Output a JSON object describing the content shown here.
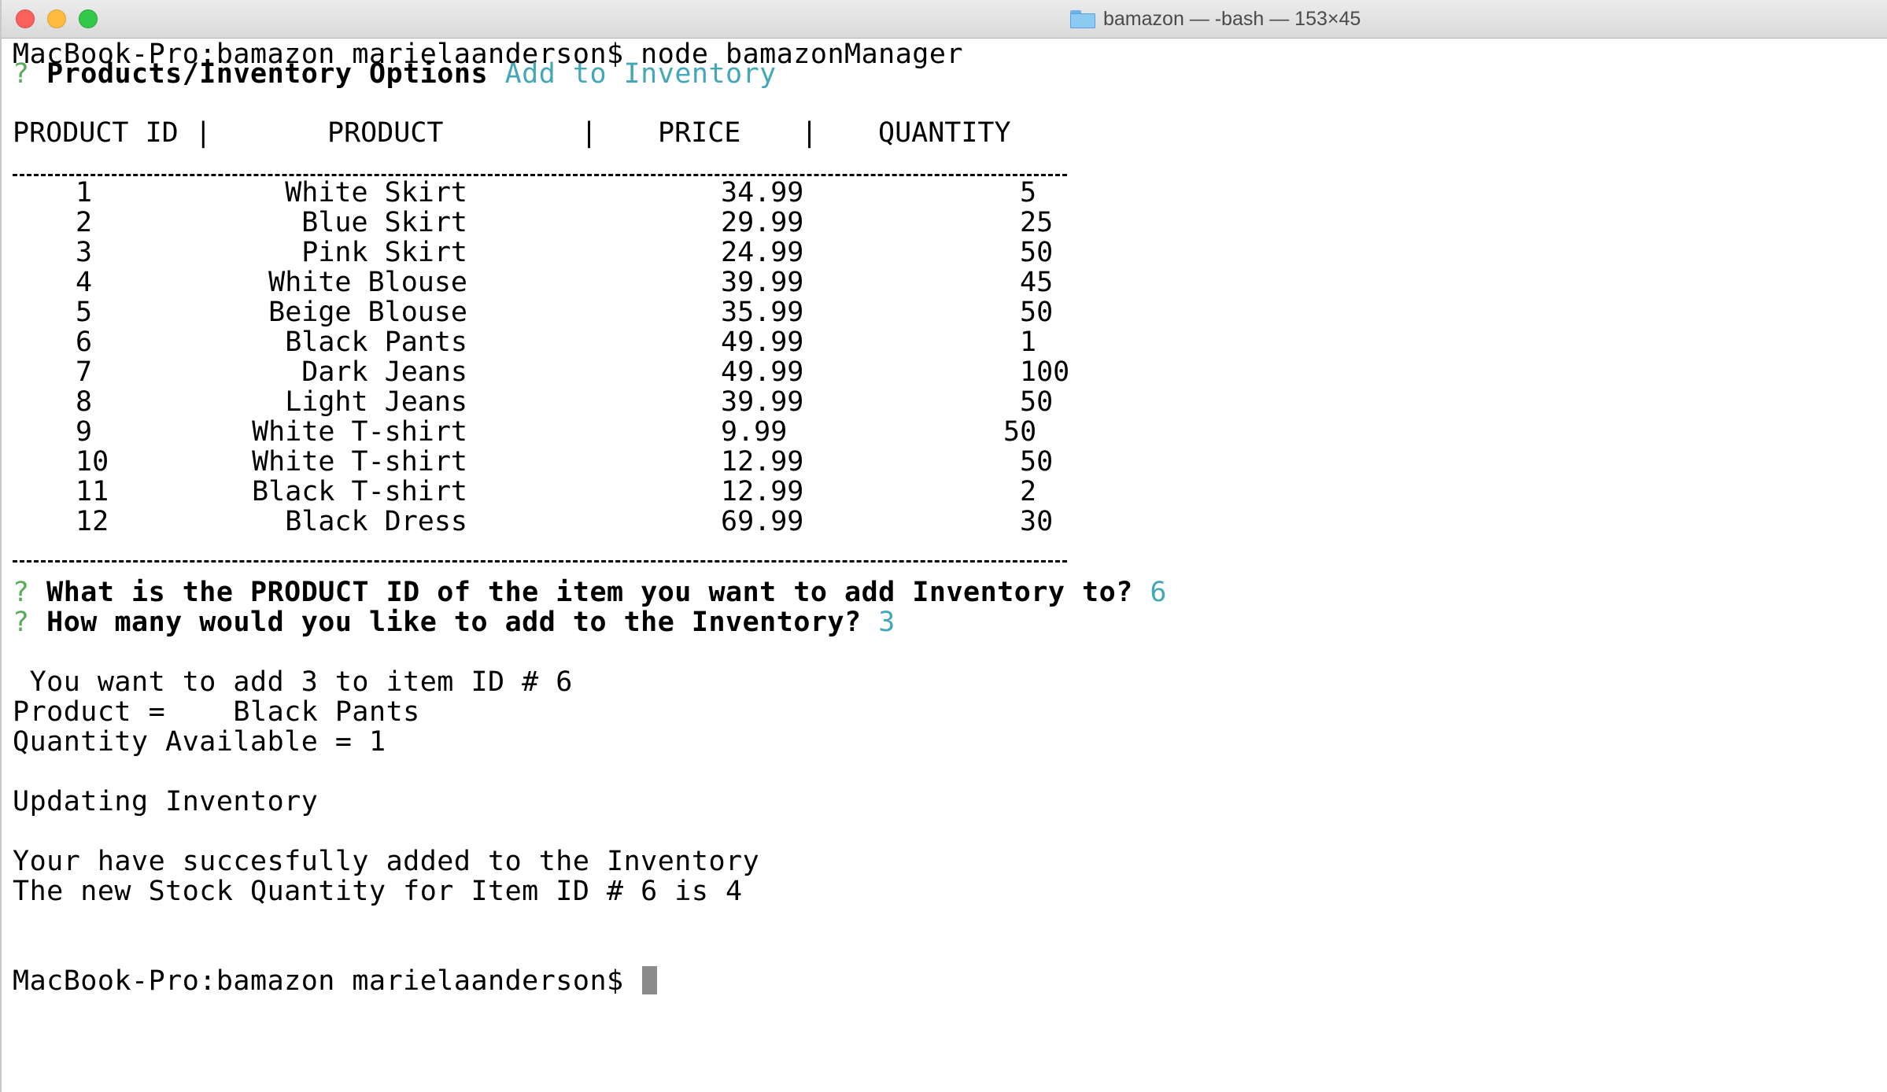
{
  "window": {
    "title": "bamazon — -bash — 153×45"
  },
  "terminal": {
    "cmd_prompt": "MacBook-Pro:bamazon marielaanderson$ ",
    "cmd_text": "node bamazonManager",
    "q_mark": "?",
    "options_question": "Products/Inventory Options",
    "options_answer": "Add to Inventory",
    "table": {
      "headers": {
        "id": "PRODUCT ID |",
        "product": "PRODUCT",
        "sep2": "|",
        "price": "PRICE",
        "sep3": "|",
        "quantity": "QUANTITY"
      },
      "rows": [
        {
          "id": "1",
          "product": "White Skirt",
          "price": "34.99",
          "quantity": "5"
        },
        {
          "id": "2",
          "product": "Blue Skirt",
          "price": "29.99",
          "quantity": "25"
        },
        {
          "id": "3",
          "product": "Pink Skirt",
          "price": "24.99",
          "quantity": "50"
        },
        {
          "id": "4",
          "product": "White Blouse",
          "price": "39.99",
          "quantity": "45"
        },
        {
          "id": "5",
          "product": "Beige Blouse",
          "price": "35.99",
          "quantity": "50"
        },
        {
          "id": "6",
          "product": "Black Pants",
          "price": "49.99",
          "quantity": "1"
        },
        {
          "id": "7",
          "product": "Dark Jeans",
          "price": "49.99",
          "quantity": "100"
        },
        {
          "id": "8",
          "product": "Light Jeans",
          "price": "39.99",
          "quantity": "50"
        },
        {
          "id": "9",
          "product": "White T-shirt",
          "price": "9.99",
          "quantity": "50"
        },
        {
          "id": "10",
          "product": "White T-shirt",
          "price": "12.99",
          "quantity": "50"
        },
        {
          "id": "11",
          "product": "Black T-shirt",
          "price": "12.99",
          "quantity": "2"
        },
        {
          "id": "12",
          "product": "Black Dress",
          "price": "69.99",
          "quantity": "30"
        }
      ]
    },
    "q1_text": "What is the PRODUCT ID of the item you want to add Inventory to?",
    "q1_answer": "6",
    "q2_text": "How many would you like to add to the Inventory?",
    "q2_answer": "3",
    "msg_add": " You want to add 3 to item ID # 6",
    "msg_product": "Product =    Black Pants",
    "msg_available": "Quantity Available = 1",
    "msg_updating": "Updating Inventory",
    "msg_success": "Your have succesfully added to the Inventory",
    "msg_new_stock": "The new Stock Quantity for Item ID # 6 is 4",
    "final_prompt": "MacBook-Pro:bamazon marielaanderson$ ",
    "colors": {
      "prompt_mark": "#5aab5a",
      "answer": "#44a7b8"
    }
  }
}
